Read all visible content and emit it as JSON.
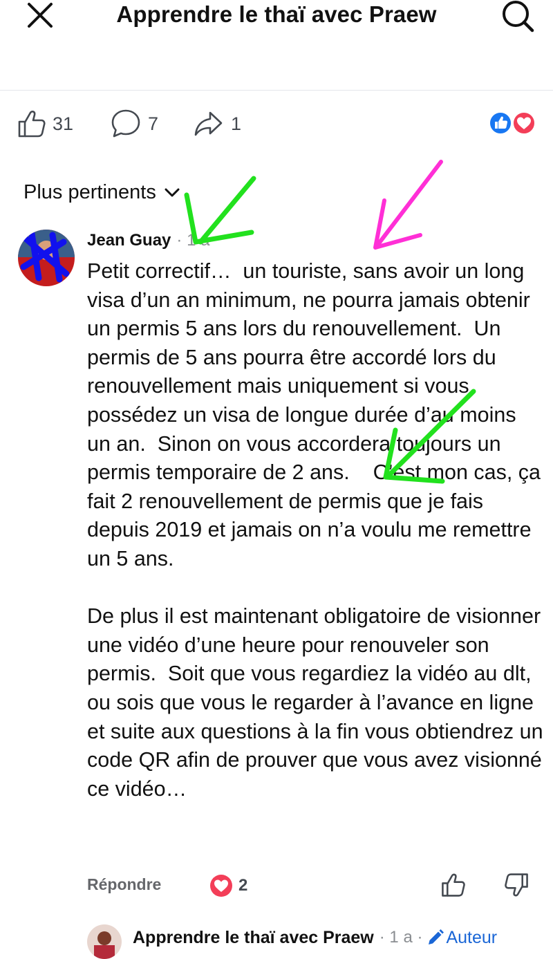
{
  "header": {
    "title": "Apprendre le thaï avec Praew",
    "close_icon": "close-icon",
    "search_icon": "search-icon"
  },
  "stats": {
    "likes": "31",
    "comments": "7",
    "shares": "1",
    "reactions": [
      "like",
      "love"
    ]
  },
  "sort": {
    "label": "Plus pertinents",
    "icon": "chevron-down-icon"
  },
  "comment": {
    "author": "Jean Guay",
    "meta": "· 1 a",
    "paragraphs": [
      "Petit correctif…  un touriste, sans avoir un long visa d’un an minimum, ne pourra jamais obtenir un permis 5 ans lors du renouvellement.  Un permis de 5 ans pourra être accordé lors du renouvellement mais uniquement si vous possédez un visa de longue durée d’au moins un an.  Sinon on vous accordera toujours un permis temporaire de 2 ans.    C’est mon cas, ça fait 2 renouvellement de permis que je fais depuis 2019 et jamais on n’a voulu me remettre un 5 ans.",
      "De plus il est maintenant obligatoire de visionner une vidéo d’une heure pour renouveler son permis.  Soit que vous regardiez la vidéo au dlt, ou sois que vous le regarder à l’avance en ligne et suite aux questions à la fin vous obtiendrez un code QR afin de prouver que vous avez visionné ce vidéo…"
    ],
    "reply_label": "Répondre",
    "heart_count": "2"
  },
  "reply": {
    "author": "Apprendre le thaï avec Praew",
    "meta": "· 1 a ·",
    "badge": "Auteur"
  },
  "colors": {
    "like_blue": "#1877f2",
    "love_red": "#f33e58",
    "annotation_green": "#22e11e",
    "annotation_magenta": "#ff2fd6",
    "author_badge_blue": "#1a66d6"
  }
}
